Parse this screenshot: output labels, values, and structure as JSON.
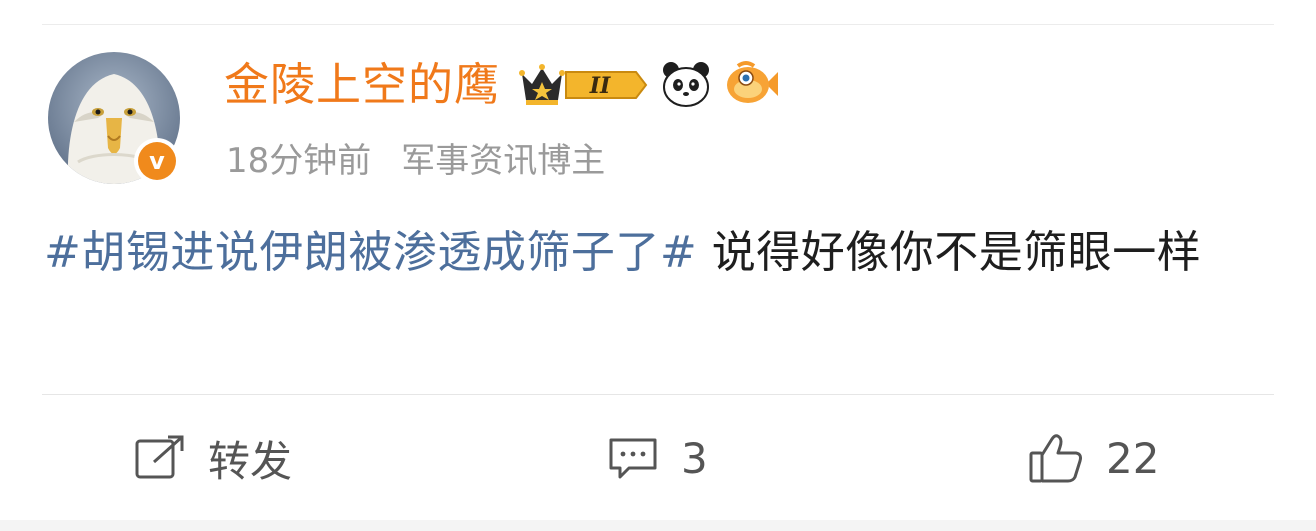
{
  "post": {
    "author": {
      "name": "金陵上空的鹰",
      "level_badge": "II",
      "verified_mark": "v"
    },
    "meta": {
      "time": "18分钟前",
      "source": "军事资讯博主"
    },
    "content": {
      "hashtag": "#胡锡进说伊朗被渗透成筛子了#",
      "text": " 说得好像你不是筛眼一样"
    },
    "actions": {
      "repost_label": "转发",
      "comment_count": "3",
      "like_count": "22"
    }
  },
  "colors": {
    "username": "#f0791a",
    "hashtag": "#4d6f9c",
    "meta": "#9a9a9a",
    "verified": "#f08a1c"
  },
  "icons": [
    "crown-level-badge-icon",
    "panda-icon",
    "fish-icon",
    "repost-icon",
    "comment-icon",
    "thumbs-up-icon"
  ]
}
